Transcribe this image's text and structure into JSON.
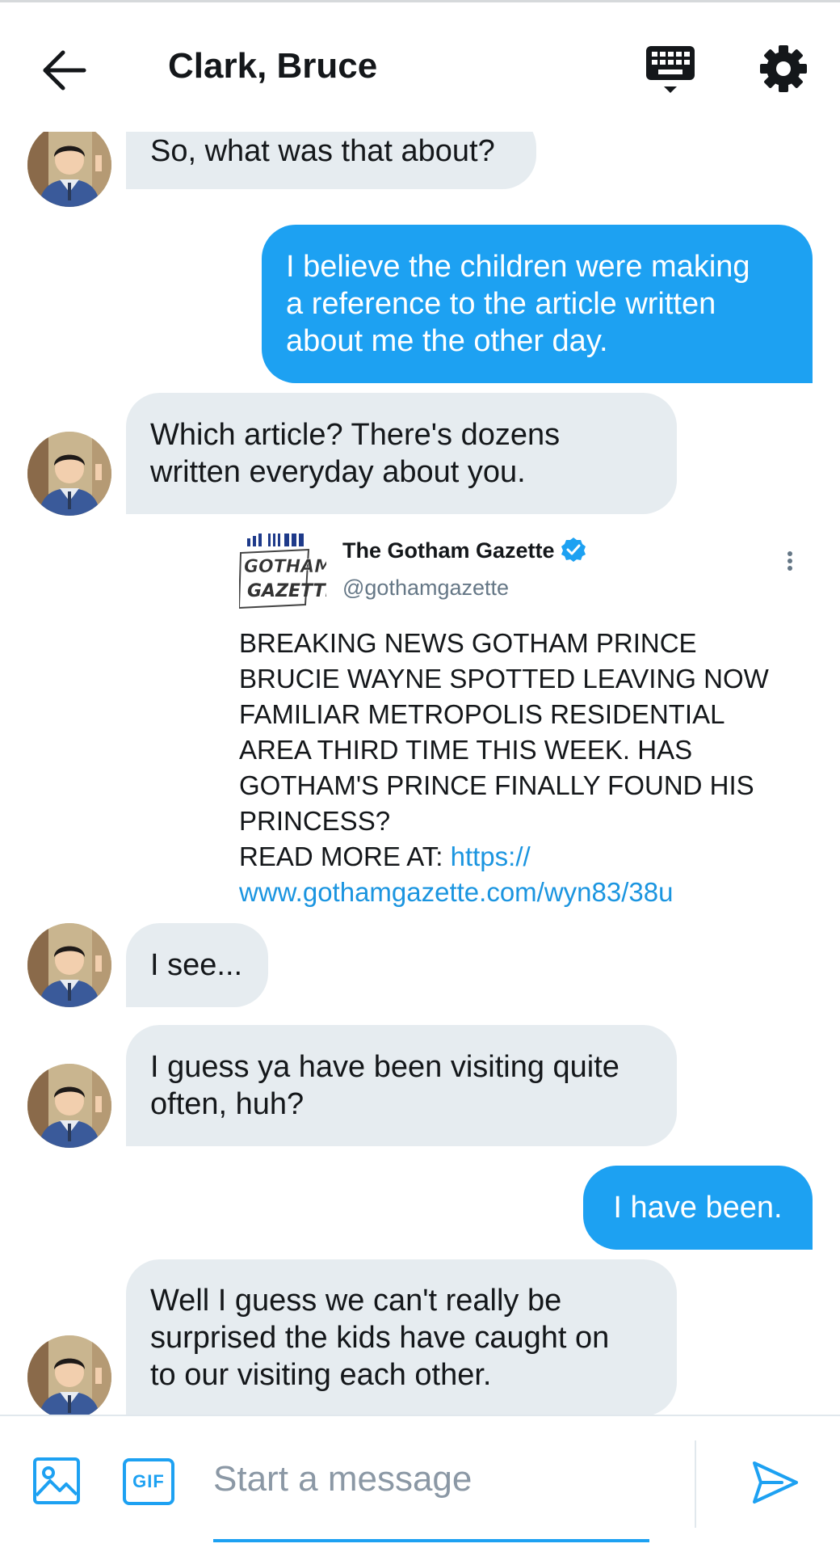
{
  "header": {
    "title": "Clark, Bruce",
    "back_icon": "arrow-left-icon",
    "keyboard_icon": "keyboard-icon",
    "settings_icon": "gear-icon"
  },
  "conversation": {
    "messages": [
      {
        "direction": "incoming",
        "lines": [
          "So, what was that about?"
        ]
      },
      {
        "direction": "outgoing",
        "lines": [
          "I believe the children were making",
          "a reference to the article written",
          "about me the other day."
        ]
      },
      {
        "direction": "incoming",
        "lines": [
          "Which article? There's dozens",
          "written everyday about you."
        ]
      },
      {
        "direction": "incoming",
        "lines": [
          "I see..."
        ]
      },
      {
        "direction": "incoming",
        "lines": [
          "I guess ya have been visiting quite",
          "often, huh?"
        ]
      },
      {
        "direction": "outgoing",
        "lines": [
          "I have been."
        ]
      },
      {
        "direction": "incoming",
        "lines": [
          "Well I guess we can't really be",
          "surprised the kids have caught on",
          "to our visiting each other."
        ]
      }
    ],
    "shared_tweet": {
      "logo_text": [
        "GOTHAM",
        "GAZETTE"
      ],
      "name": "The Gotham Gazette",
      "handle": "@gothamgazette",
      "body_lines": [
        "BREAKING NEWS GOTHAM PRINCE",
        "BRUCIE WAYNE SPOTTED LEAVING NOW",
        "FAMILIAR METROPOLIS RESIDENTIAL",
        "AREA THIRD TIME THIS WEEK. HAS",
        "GOTHAM'S PRINCE FINALLY FOUND HIS",
        "PRINCESS?"
      ],
      "read_more_label": "READ MORE AT: ",
      "link_line_1": "https://",
      "link_line_2": "www.gothamgazette.com/wyn83/38u"
    }
  },
  "composer": {
    "gif_label": "GIF",
    "placeholder": "Start a message",
    "value": ""
  },
  "colors": {
    "accent": "#1da1f2",
    "incoming_bubble": "#e6ecf0",
    "link": "#1b95e0"
  }
}
